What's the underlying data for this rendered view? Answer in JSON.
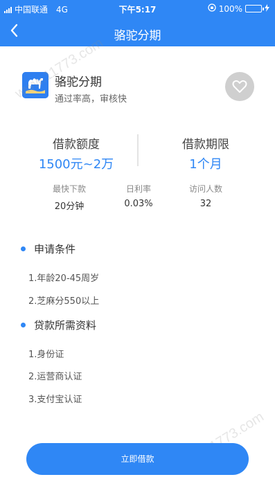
{
  "status_bar": {
    "carrier": "中国联通",
    "network": "4G",
    "time": "下午5:17",
    "battery": "100%",
    "battery_level": 1.0
  },
  "nav": {
    "title": "骆驼分期",
    "back_icon": "chevron-left-icon"
  },
  "app": {
    "name": "骆驼分期",
    "description": "通过率高，审核快",
    "logo_icon": "camel-logo-icon",
    "favorite_icon": "heart-icon"
  },
  "amounts": {
    "limit_label": "借款额度",
    "limit_value": "1500元~2万",
    "term_label": "借款期限",
    "term_value": "1个月"
  },
  "stats": [
    {
      "label": "最快下款",
      "value": "20分钟"
    },
    {
      "label": "日利率",
      "value": "0.03%"
    },
    {
      "label": "访问人数",
      "value": "32"
    }
  ],
  "conditions": {
    "title": "申请条件",
    "items": [
      "1.年龄20-45周岁",
      "2.芝麻分550以上"
    ]
  },
  "materials": {
    "title": "贷款所需资料",
    "items": [
      "1.身份证",
      "2.运营商认证",
      "3.支付宝认证"
    ]
  },
  "cta": {
    "label": "立即借款"
  },
  "watermark": {
    "text": "www.11773.com"
  },
  "colors": {
    "primary": "#2f87f5",
    "battery_fill": "#7ed321"
  }
}
